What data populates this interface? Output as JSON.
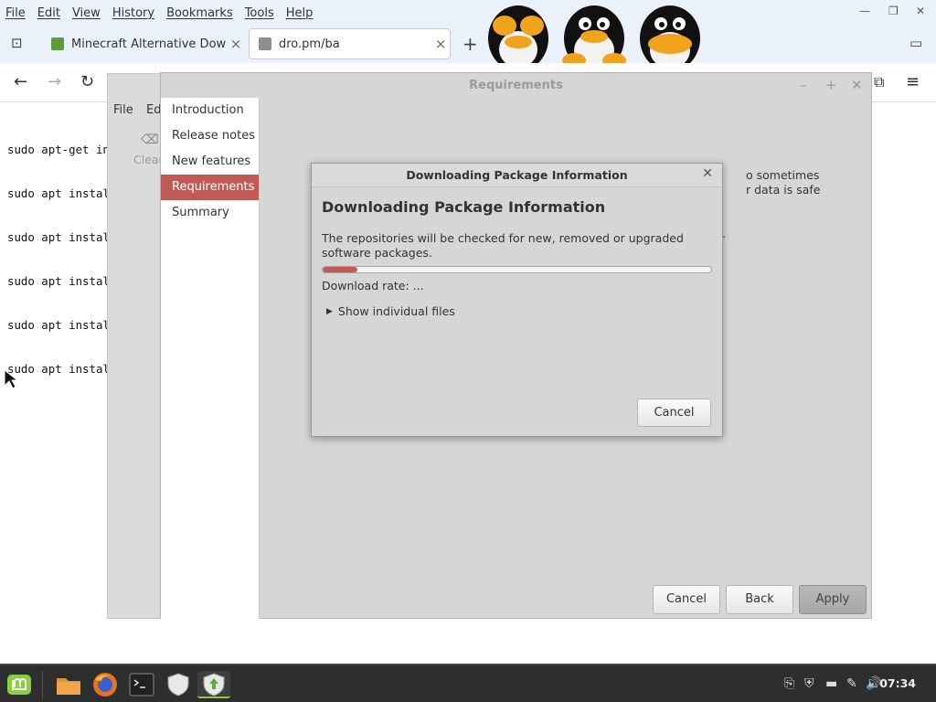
{
  "browser": {
    "menu": [
      "File",
      "Edit",
      "View",
      "History",
      "Bookmarks",
      "Tools",
      "Help"
    ],
    "tabs": [
      {
        "label": "Minecraft Alternative Down"
      },
      {
        "label": "dro.pm/ba"
      }
    ]
  },
  "page": {
    "lines": [
      "sudo apt-get in",
      "sudo apt instal",
      "sudo apt instal",
      "sudo apt instal",
      "sudo apt instal",
      "sudo apt instal"
    ]
  },
  "back_window": {
    "menu_file": "File",
    "menu_edit": "Edi",
    "clear_label": "Clear"
  },
  "upgrade_window": {
    "title": "Requirements",
    "sidebar": [
      "Introduction",
      "Release notes",
      "New features",
      "Requirements",
      "Summary"
    ],
    "selected": "Requirements",
    "partial_text": [
      "o sometimes",
      "r data is safe",
      "."
    ],
    "buttons": {
      "cancel": "Cancel",
      "back": "Back",
      "apply": "Apply"
    }
  },
  "dialog": {
    "title": "Downloading Package Information",
    "heading": "Downloading Package Information",
    "message": "The repositories will be checked for new, removed or upgraded software packages.",
    "progress": 0.09,
    "download_rate": "Download rate: ...",
    "expander": "Show individual files",
    "cancel": "Cancel"
  },
  "taskbar": {
    "clock": "07:34"
  },
  "colors": {
    "accent": "#c05a55",
    "mint": "#87cf3e"
  }
}
